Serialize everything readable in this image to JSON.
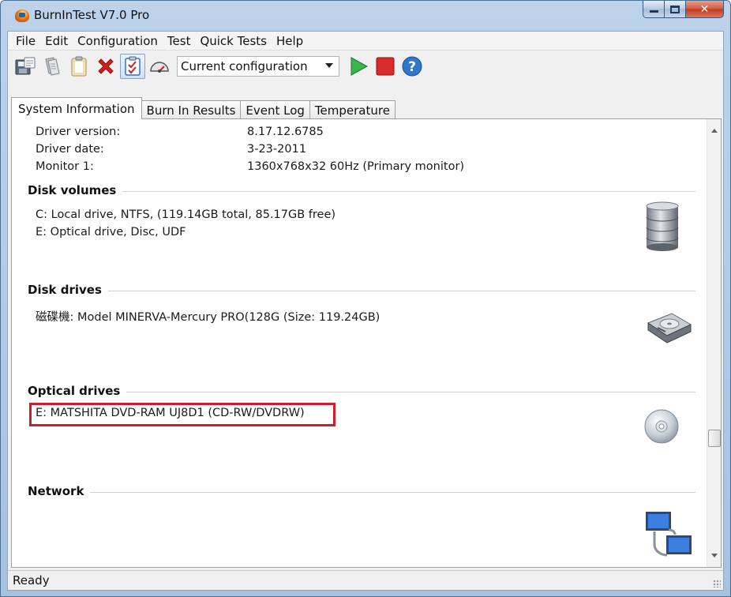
{
  "window": {
    "title": "BurnInTest V7.0 Pro"
  },
  "menu": [
    "File",
    "Edit",
    "Configuration",
    "Test",
    "Quick Tests",
    "Help"
  ],
  "toolbar": {
    "config_select": "Current configuration",
    "icons": [
      "save-results-icon",
      "copy-icon",
      "clipboard-icon",
      "delete-icon",
      "checklist-icon",
      "gauge-icon",
      "play-icon",
      "stop-icon",
      "help-icon"
    ],
    "colors": {
      "play": "#3bb54a",
      "stop": "#d92b2b",
      "help": "#2f78c8",
      "delete": "#d0201e"
    }
  },
  "tabs": [
    "System Information",
    "Burn In Results",
    "Event Log",
    "Temperature"
  ],
  "display_info": [
    {
      "label": "Driver version:",
      "value": "8.17.12.6785"
    },
    {
      "label": "Driver date:",
      "value": "3-23-2011"
    },
    {
      "label": "Monitor 1:",
      "value": "1360x768x32 60Hz (Primary monitor)"
    }
  ],
  "sections": {
    "disk_volumes": {
      "title": "Disk volumes",
      "lines": [
        "C:  Local drive, NTFS, (119.14GB total, 85.17GB free)",
        "E:  Optical drive, Disc, UDF"
      ]
    },
    "disk_drives": {
      "title": "Disk drives",
      "lines": [
        "磁碟機: Model MINERVA-Mercury PRO(128G (Size: 119.24GB)"
      ]
    },
    "optical_drives": {
      "title": "Optical drives",
      "lines": [
        "E: MATSHITA DVD-RAM UJ8D1 (CD-RW/DVDRW)"
      ],
      "highlight_color": "#cc1f2a"
    },
    "network": {
      "title": "Network"
    }
  },
  "status": {
    "text": "Ready"
  }
}
